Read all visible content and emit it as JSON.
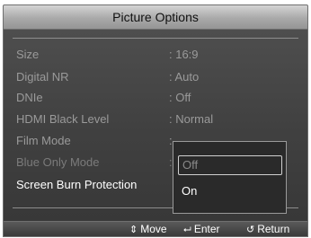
{
  "window": {
    "title": "Picture Options"
  },
  "menu": {
    "items": [
      {
        "label": "Size",
        "value": ": 16:9"
      },
      {
        "label": "Digital NR",
        "value": ": Auto"
      },
      {
        "label": "DNIe",
        "value": ": Off"
      },
      {
        "label": "HDMI Black Level",
        "value": ": Normal"
      },
      {
        "label": "Film Mode",
        "value": ":"
      },
      {
        "label": "Blue Only Mode",
        "value": ":"
      },
      {
        "label": "Screen Burn Protection",
        "value": ""
      }
    ]
  },
  "dropdown": {
    "options": [
      "Off",
      "On"
    ],
    "highlighted": "Off"
  },
  "footer": {
    "move_label": "Move",
    "enter_label": "Enter",
    "return_label": "Return",
    "move_icon": "up-down-arrows-icon",
    "enter_icon": "enter-icon",
    "return_icon": "return-icon"
  },
  "colors": {
    "panel": "#444444",
    "title_bar": "#b5b5b5",
    "text_active": "#ffffff",
    "text_inactive": "#9a9a9a"
  }
}
